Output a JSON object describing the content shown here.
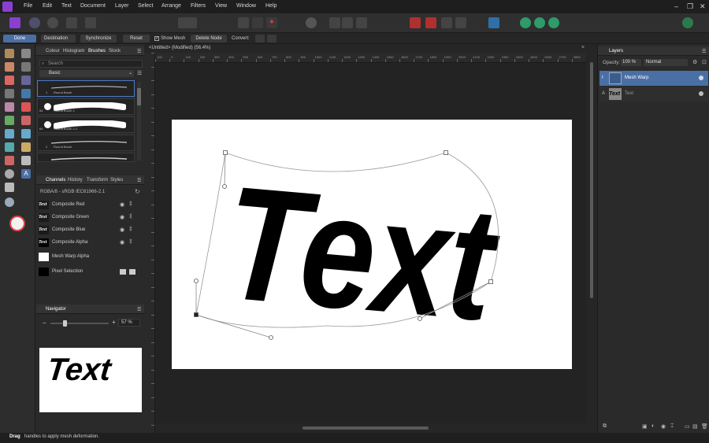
{
  "menu": [
    "File",
    "Edit",
    "Text",
    "Document",
    "Layer",
    "Select",
    "Arrange",
    "Filters",
    "View",
    "Window",
    "Help"
  ],
  "context_bar": {
    "done": "Done",
    "destination": "Destination",
    "synchronize": "Synchronize",
    "reset": "Reset",
    "show_mesh": "Show Mesh",
    "delete_node": "Delete Node",
    "convert": "Convert:"
  },
  "left_panel": {
    "tabs": [
      "Colour",
      "Histogram",
      "Brushes",
      "Stock"
    ],
    "search_placeholder": "Search",
    "category": "Basic",
    "brushes": [
      {
        "num": "1",
        "name": "Round Brush"
      },
      {
        "num": "64",
        "name": "Round Brush 2"
      },
      {
        "num": "64",
        "name": "Round Brush 2.2"
      },
      {
        "num": "2",
        "name": "Round Brush"
      }
    ],
    "channels_tabs": [
      "Channels",
      "History",
      "Transform",
      "Styles"
    ],
    "color_profile": "RGBA/8 - sRGB IEC61966-2.1",
    "channels": [
      "Composite Red",
      "Composite Green",
      "Composite Blue",
      "Composite Alpha",
      "Mesh Warp Alpha",
      "Pixel Selection"
    ],
    "navigator_tab": "Navigator",
    "zoom": "57 %",
    "preview_text": "Text"
  },
  "document": {
    "tab_title": "<Untitled> (Modified) (56.4%)",
    "artwork_text": "Text",
    "ruler_labels": [
      "100",
      "0",
      "100",
      "200",
      "300",
      "400",
      "500",
      "600",
      "700",
      "800",
      "900",
      "1000",
      "1100",
      "1200",
      "1300",
      "1400",
      "1500",
      "1600",
      "1700",
      "1800",
      "1900",
      "2000",
      "2100",
      "2200",
      "2300",
      "2400",
      "2500",
      "2600",
      "2700",
      "2800"
    ]
  },
  "layers_panel": {
    "tab": "Layers",
    "opacity_label": "Opacity:",
    "opacity_value": "100 %",
    "blend_mode": "Normal",
    "layers": [
      {
        "type_letter": "I",
        "name": "Mesh Warp",
        "selected": true
      },
      {
        "type_letter": "A",
        "name": "Text",
        "thumb_text": "Text",
        "selected": false
      }
    ]
  },
  "status": {
    "bold": "Drag",
    "text": "handles to apply mesh deformation."
  },
  "colors": {
    "accent": "#4a6fa5",
    "app_logo": "#8a3fd0",
    "canvas": "#232323"
  }
}
